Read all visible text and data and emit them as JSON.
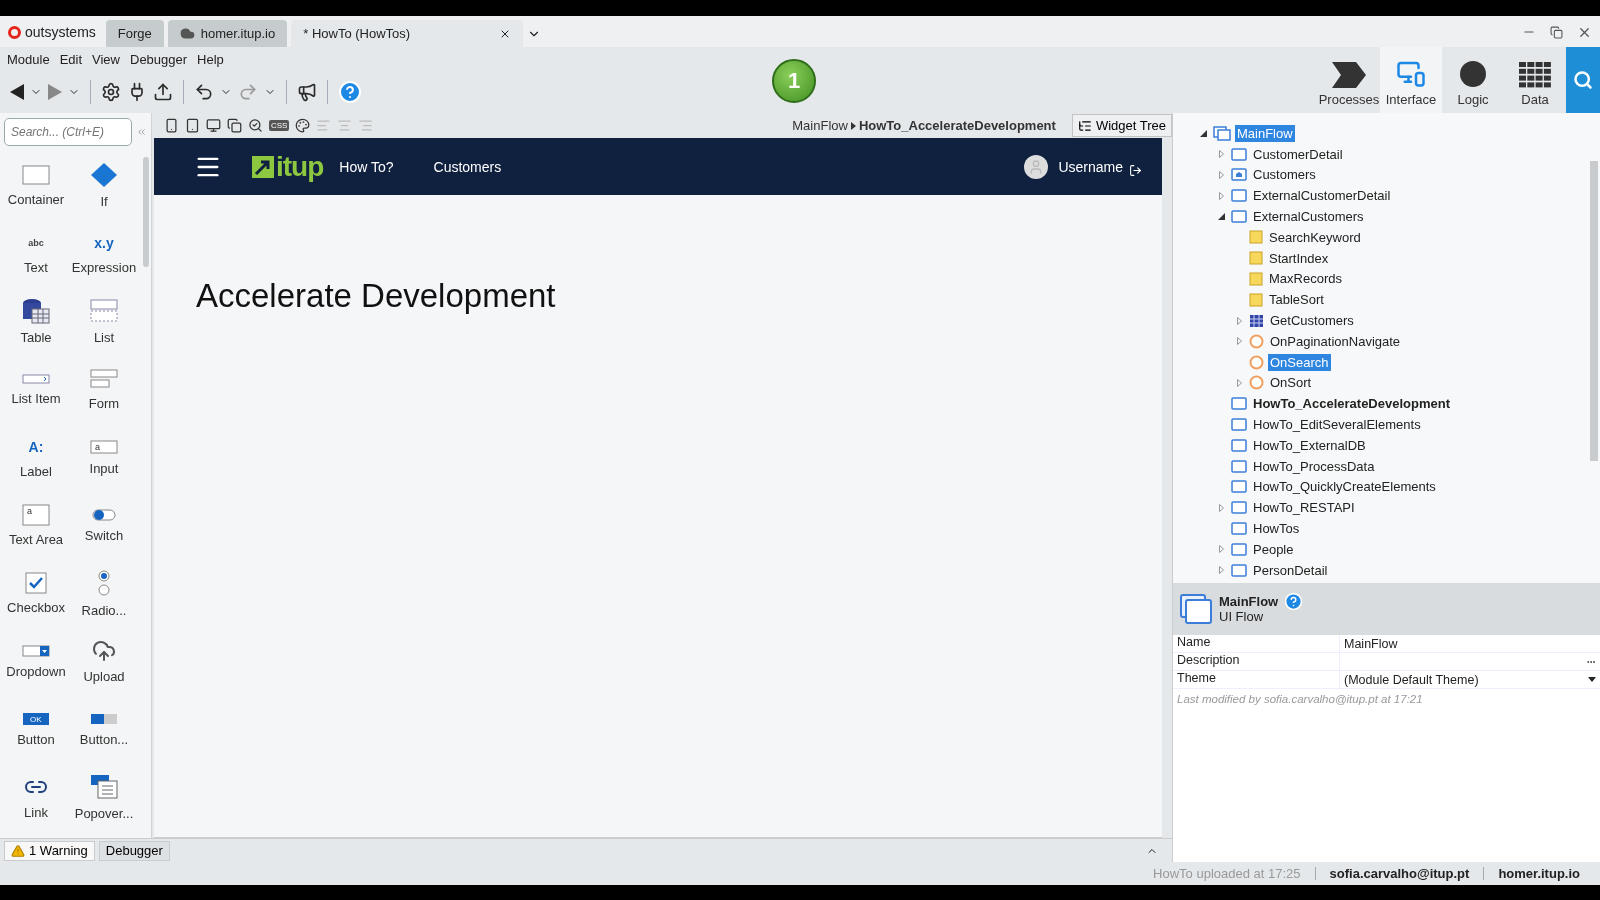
{
  "brand": "outsystems",
  "tabs": [
    {
      "label": "Forge",
      "kind": "plain",
      "selected": false
    },
    {
      "label": "homer.itup.io",
      "kind": "server",
      "selected": false
    },
    {
      "label": "* HowTo (HowTos)",
      "kind": "module",
      "selected": true
    }
  ],
  "menu": [
    "Module",
    "Edit",
    "View",
    "Debugger",
    "Help"
  ],
  "badge": "1",
  "nav_tabs": [
    {
      "label": "Processes",
      "selected": false
    },
    {
      "label": "Interface",
      "selected": true
    },
    {
      "label": "Logic",
      "selected": false
    },
    {
      "label": "Data",
      "selected": false
    }
  ],
  "toolbox": {
    "search_placeholder": "Search... (Ctrl+E)",
    "items": [
      {
        "label": "Container",
        "kind": "container"
      },
      {
        "label": "If",
        "kind": "if"
      },
      {
        "label": "Text",
        "kind": "glyph",
        "glyph": "abc"
      },
      {
        "label": "Expression",
        "kind": "glyph",
        "glyph": "x.y"
      },
      {
        "label": "Table",
        "kind": "table"
      },
      {
        "label": "List",
        "kind": "list"
      },
      {
        "label": "List Item",
        "kind": "listitem"
      },
      {
        "label": "Form",
        "kind": "form"
      },
      {
        "label": "Label",
        "kind": "glyph",
        "glyph": "A:"
      },
      {
        "label": "Input",
        "kind": "input",
        "glyph": "a"
      },
      {
        "label": "Text Area",
        "kind": "textarea",
        "glyph": "a"
      },
      {
        "label": "Switch",
        "kind": "switch"
      },
      {
        "label": "Checkbox",
        "kind": "checkbox"
      },
      {
        "label": "Radio...",
        "kind": "radio"
      },
      {
        "label": "Dropdown",
        "kind": "dropdown"
      },
      {
        "label": "Upload",
        "kind": "upload"
      },
      {
        "label": "Button",
        "kind": "button",
        "glyph": "OK"
      },
      {
        "label": "Button...",
        "kind": "buttongroup"
      },
      {
        "label": "Link",
        "kind": "link"
      },
      {
        "label": "Popover...",
        "kind": "popover"
      }
    ]
  },
  "canvas_toolbar": {
    "css_glyph": "CSS"
  },
  "breadcrumb": {
    "parent": "MainFlow",
    "current": "HowTo_AccelerateDevelopment"
  },
  "widget_tree_button": "Widget Tree",
  "preview": {
    "logo": "itup",
    "nav": [
      "How To?",
      "Customers"
    ],
    "user": "Username",
    "heading": "Accelerate Development"
  },
  "tree": [
    {
      "label": "MainFlow",
      "kind": "flow",
      "expanded": true,
      "selected": true,
      "current": false,
      "children": [
        {
          "label": "CustomerDetail",
          "kind": "screen",
          "expanded": false,
          "selected": false,
          "current": false
        },
        {
          "label": "Customers",
          "kind": "home",
          "expanded": false,
          "selected": false,
          "current": false
        },
        {
          "label": "ExternalCustomerDetail",
          "kind": "screen",
          "expanded": false,
          "selected": false,
          "current": false
        },
        {
          "label": "ExternalCustomers",
          "kind": "screen",
          "expanded": true,
          "selected": false,
          "current": false,
          "children": [
            {
              "label": "SearchKeyword",
              "kind": "variable",
              "selected": false,
              "current": false
            },
            {
              "label": "StartIndex",
              "kind": "variable",
              "selected": false,
              "current": false
            },
            {
              "label": "MaxRecords",
              "kind": "variable",
              "selected": false,
              "current": false
            },
            {
              "label": "TableSort",
              "kind": "variable",
              "selected": false,
              "current": false
            },
            {
              "label": "GetCustomers",
              "kind": "aggregate",
              "expanded": false,
              "selected": false,
              "current": false
            },
            {
              "label": "OnPaginationNavigate",
              "kind": "action",
              "expanded": false,
              "selected": false,
              "current": false
            },
            {
              "label": "OnSearch",
              "kind": "action",
              "selected": true,
              "current": false
            },
            {
              "label": "OnSort",
              "kind": "action",
              "expanded": false,
              "selected": false,
              "current": false
            }
          ]
        },
        {
          "label": "HowTo_AccelerateDevelopment",
          "kind": "screen",
          "selected": false,
          "current": true
        },
        {
          "label": "HowTo_EditSeveralElements",
          "kind": "screen",
          "selected": false,
          "current": false
        },
        {
          "label": "HowTo_ExternalDB",
          "kind": "screen",
          "selected": false,
          "current": false
        },
        {
          "label": "HowTo_ProcessData",
          "kind": "screen",
          "selected": false,
          "current": false
        },
        {
          "label": "HowTo_QuicklyCreateElements",
          "kind": "screen",
          "selected": false,
          "current": false
        },
        {
          "label": "HowTo_RESTAPI",
          "kind": "screen",
          "expanded": false,
          "selected": false,
          "current": false
        },
        {
          "label": "HowTos",
          "kind": "screen",
          "selected": false,
          "current": false
        },
        {
          "label": "People",
          "kind": "screen",
          "expanded": false,
          "selected": false,
          "current": false
        },
        {
          "label": "PersonDetail",
          "kind": "screen",
          "expanded": false,
          "selected": false,
          "current": false
        }
      ]
    }
  ],
  "properties": {
    "title": "MainFlow",
    "subtitle": "UI Flow",
    "rows": [
      {
        "label": "Name",
        "value": "MainFlow",
        "kind": "text"
      },
      {
        "label": "Description",
        "kind": "textarea"
      },
      {
        "label": "Theme",
        "value": "(Module Default Theme)",
        "kind": "dropdown"
      }
    ],
    "note": "Last modified by sofia.carvalho@itup.pt at 17:21"
  },
  "bottom_tabs": [
    {
      "label": "1 Warning",
      "kind": "warning"
    },
    {
      "label": "Debugger",
      "kind": "plain"
    }
  ],
  "status": [
    {
      "text": "HowTo uploaded at 17:25",
      "kind": "muted"
    },
    {
      "text": "sofia.carvalho@itup.pt",
      "kind": "strong"
    },
    {
      "text": "homer.itup.io",
      "kind": "strong"
    }
  ]
}
